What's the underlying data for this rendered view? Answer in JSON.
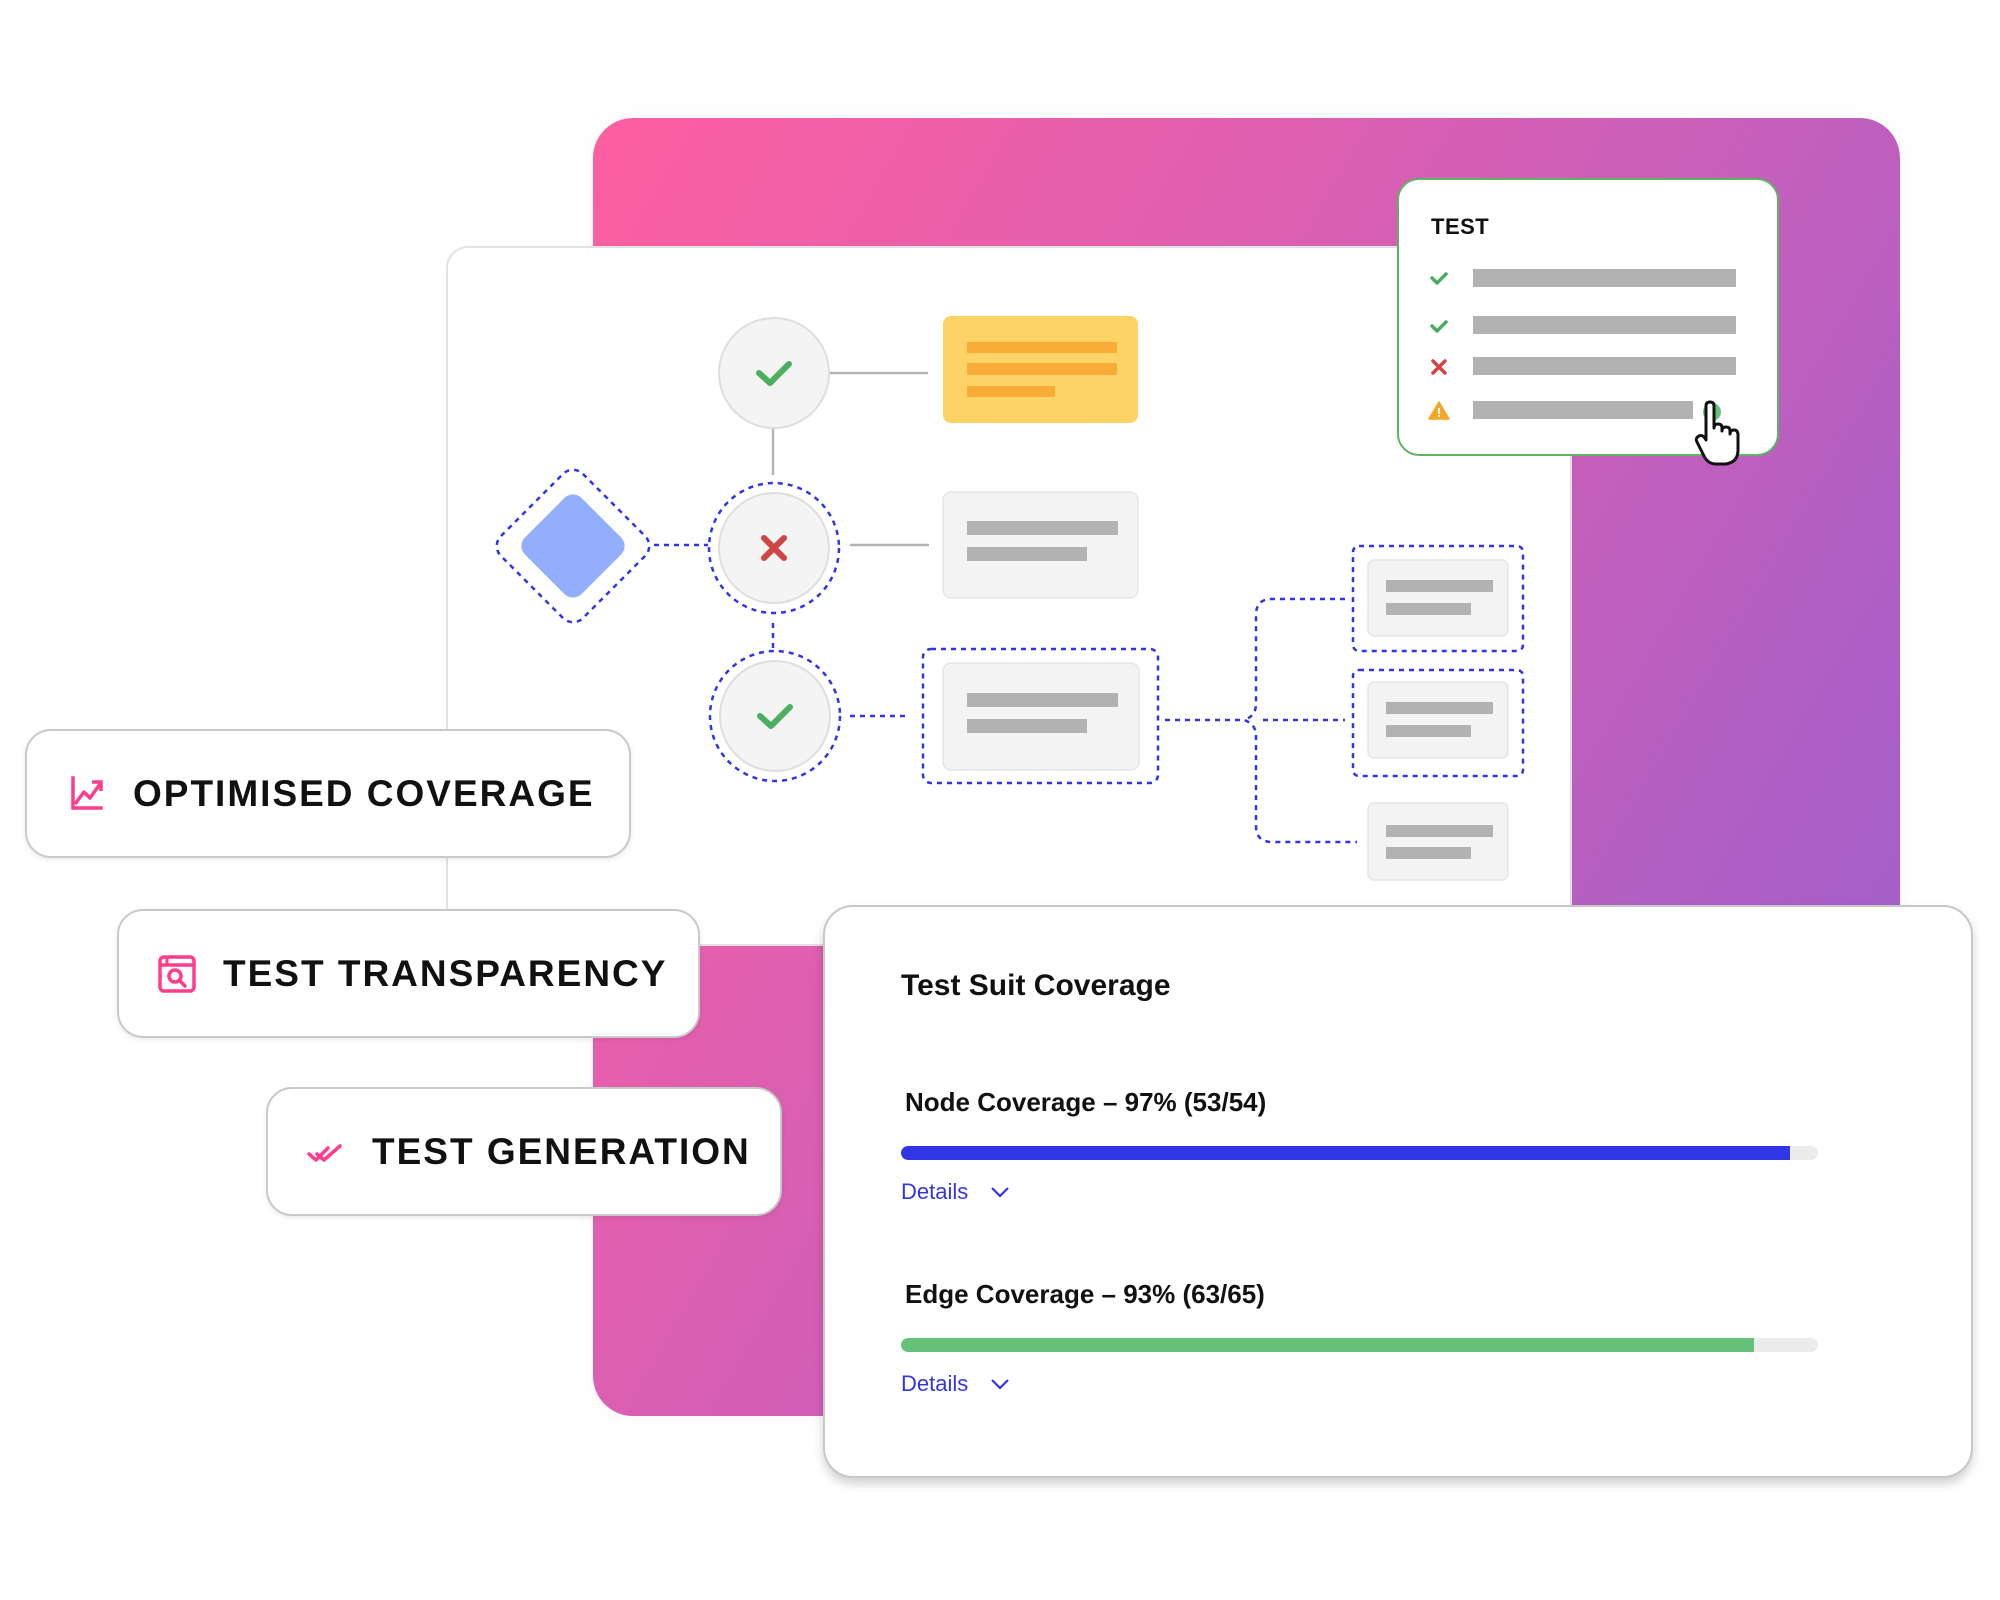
{
  "test_panel": {
    "title": "TEST",
    "rows": [
      {
        "status": "pass",
        "icon": "check-icon"
      },
      {
        "status": "pass",
        "icon": "check-icon"
      },
      {
        "status": "fail",
        "icon": "x-icon"
      },
      {
        "status": "warning",
        "icon": "warning-icon"
      }
    ]
  },
  "features": [
    {
      "label": "OPTIMISED COVERAGE",
      "icon": "trending-chart-icon"
    },
    {
      "label": "TEST TRANSPARENCY",
      "icon": "browser-search-icon"
    },
    {
      "label": "TEST GENERATION",
      "icon": "double-check-icon"
    }
  ],
  "coverage": {
    "title": "Test Suit Coverage",
    "metrics": [
      {
        "label": "Node Coverage – 97% (53/54)",
        "percent": 97,
        "covered": 53,
        "total": 54,
        "color": "#3035e6",
        "details_label": "Details"
      },
      {
        "label": "Edge Coverage – 93% (63/65)",
        "percent": 93,
        "covered": 63,
        "total": 65,
        "color": "#66c27a",
        "details_label": "Details"
      }
    ]
  },
  "flow_diagram": {
    "nodes": [
      {
        "id": "decision",
        "shape": "diamond",
        "selected": true
      },
      {
        "id": "step-1",
        "status": "pass",
        "icon": "check-icon",
        "selected": false
      },
      {
        "id": "step-2",
        "status": "fail",
        "icon": "x-icon",
        "selected": true
      },
      {
        "id": "step-3",
        "status": "pass",
        "icon": "check-icon",
        "selected": true
      }
    ]
  },
  "colors": {
    "accent_pink": "#ff3d8b",
    "pass_green": "#4caf5f",
    "fail_red": "#d04444",
    "warning_orange": "#f5a623",
    "selection_blue": "#3035e6",
    "diamond_blue": "#93aefc",
    "note_yellow": "#fdd365"
  }
}
